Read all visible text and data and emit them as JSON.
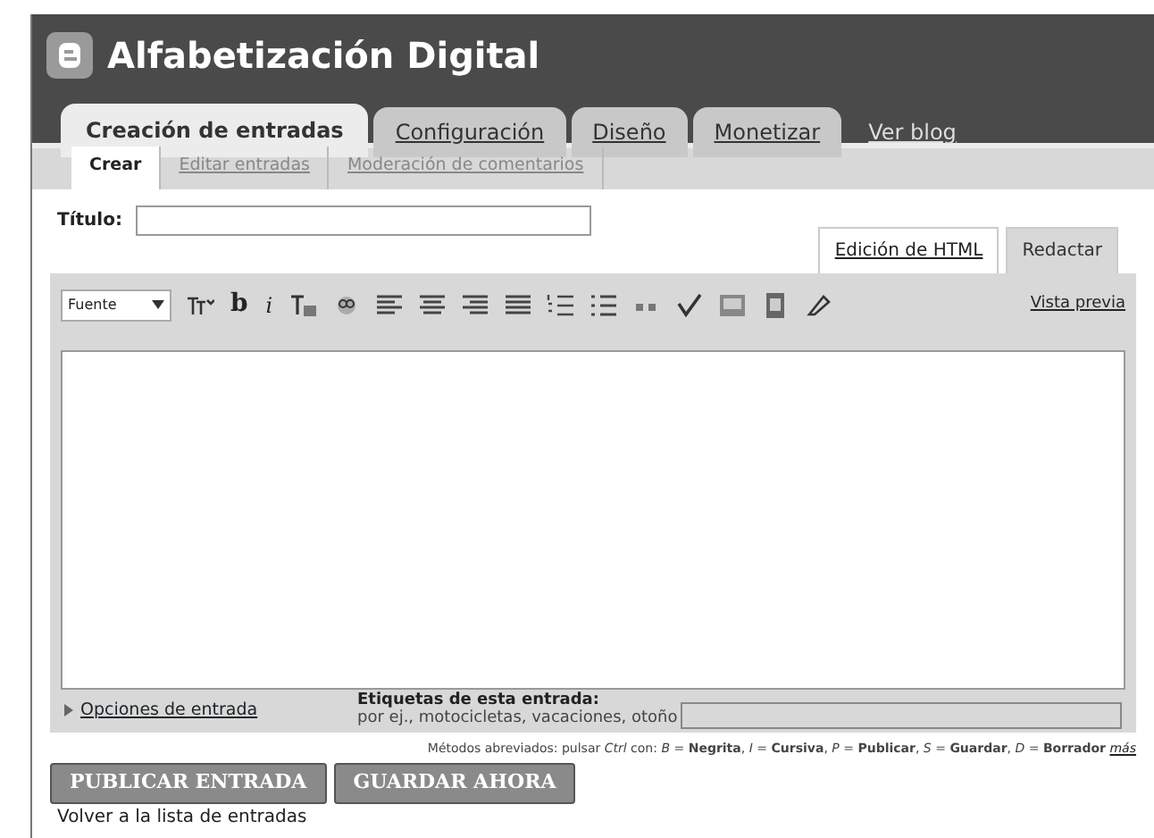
{
  "header": {
    "title": "Alfabetización Digital"
  },
  "tabs": [
    {
      "label": "Creación de entradas",
      "selected": true
    },
    {
      "label": "Configuración",
      "selected": false
    },
    {
      "label": "Diseño",
      "selected": false
    },
    {
      "label": "Monetizar",
      "selected": false
    },
    {
      "label": "Ver blog",
      "selected": false,
      "kind": "link"
    }
  ],
  "subtabs": [
    {
      "label": "Crear",
      "selected": true
    },
    {
      "label": "Editar entradas",
      "selected": false
    },
    {
      "label": "Moderación de comentarios",
      "selected": false
    }
  ],
  "title_field": {
    "label": "Título:"
  },
  "editor_tabs": [
    {
      "label": "Edición de HTML",
      "selected": false
    },
    {
      "label": "Redactar",
      "selected": true
    }
  ],
  "toolbar": {
    "font_select": "Fuente",
    "bold": "b",
    "italic": "i",
    "preview": "Vista previa"
  },
  "options": {
    "link": "Opciones de entrada",
    "labels_title": "Etiquetas de esta entrada:",
    "labels_hint": "por ej., motocicletas, vacaciones, otoño"
  },
  "shortcuts": {
    "text": "Métodos abreviados: pulsar *Ctrl* con: *B* = **Negrita**, *I* = **Cursiva**, *P* = **Publicar**, *S* = **Guardar**, *D* = **Borrador**",
    "more": "más"
  },
  "buttons": [
    "PUBLICAR ENTRADA",
    "GUARDAR AHORA"
  ],
  "back_link": "Volver a la lista de entradas"
}
